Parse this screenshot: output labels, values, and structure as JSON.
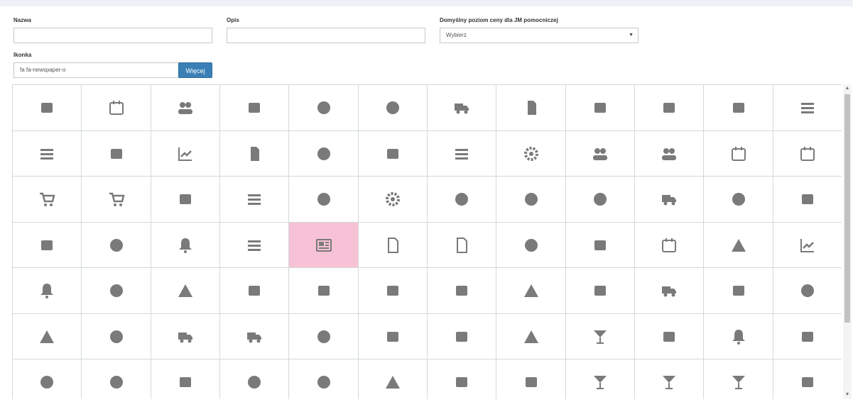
{
  "form": {
    "nazwa_label": "Nazwa",
    "nazwa_value": "",
    "opis_label": "Opis",
    "opis_value": "",
    "price_level_label": "Domyślny poziom ceny dla JM pomocniczej",
    "price_level_selected": "Wybierz",
    "ikonka_label": "Ikonka",
    "ikonka_value": "fa fa-newspaper-o",
    "more_button": "Więcej"
  },
  "colors": {
    "icon": "#7a7a7a",
    "selected_bg": "#f7c2d6",
    "button_bg": "#3a7fb5"
  },
  "icon_grid": {
    "selected": "newspaper",
    "rows": [
      [
        "fax",
        "calendar",
        "users",
        "address-card",
        "handshake-hand",
        "donate",
        "truck",
        "copy",
        "folder-open",
        "folder",
        "book",
        "tasks"
      ],
      [
        "server",
        "sitemap",
        "chart-line",
        "file",
        "handshake",
        "table",
        "align-center",
        "cogs",
        "users-group",
        "user-plus",
        "calendar-check",
        "calendar-plus"
      ],
      [
        "cart",
        "cart-plus",
        "gift",
        "list-alt",
        "paperclip",
        "cog",
        "horse",
        "accessible",
        "raspberry",
        "ambulance",
        "anchor",
        "archway"
      ],
      [
        "archive",
        "gavel-axe",
        "bell",
        "university",
        "newspaper",
        "file-text",
        "file-o",
        "coins",
        "credit-card",
        "calendar-o",
        "hourglass",
        "area-chart"
      ],
      [
        "bell-solid",
        "gavel",
        "balance-scale",
        "bed",
        "beer",
        "birthday-cake",
        "blender",
        "flask",
        "building",
        "bus",
        "camera-retro",
        "bottle"
      ],
      [
        "campground",
        "capsules",
        "car",
        "caravan",
        "cat",
        "chair",
        "charging-station",
        "cheese",
        "cocktail",
        "coffee",
        "concierge-bell",
        "cubes"
      ],
      [
        "money-hand",
        "drumstick",
        "dumpster",
        "egg",
        "fish",
        "flask-solid",
        "gas-pump",
        "gifts",
        "glass-cheers",
        "glass-martini",
        "glass-martini-alt",
        "glass-whiskey"
      ]
    ]
  }
}
